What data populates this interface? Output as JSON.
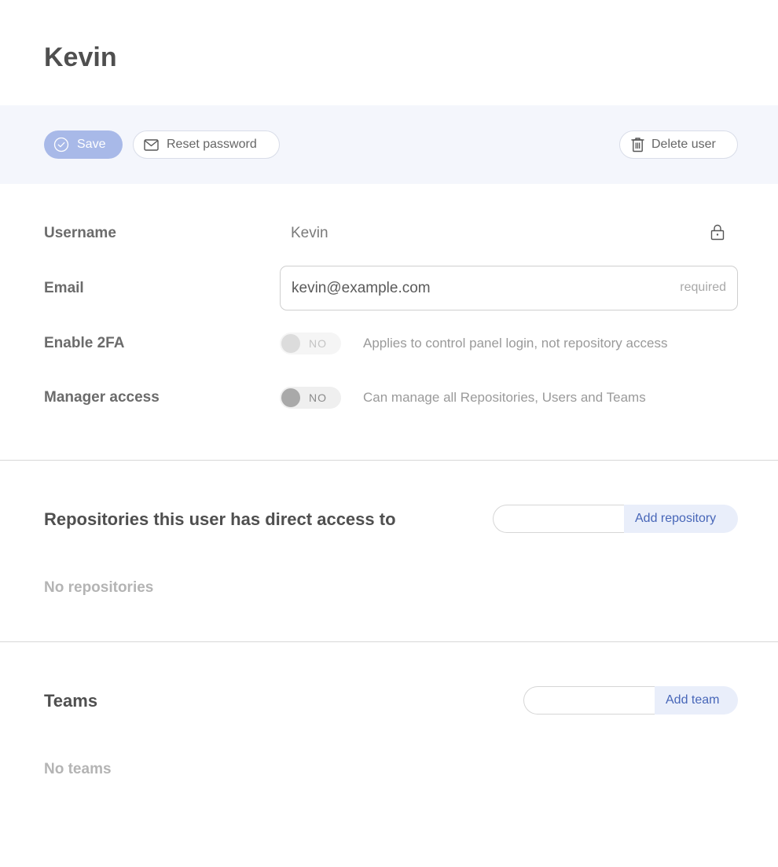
{
  "header": {
    "title": "Kevin"
  },
  "toolbar": {
    "save_label": "Save",
    "reset_password_label": "Reset password",
    "delete_user_label": "Delete user"
  },
  "fields": {
    "username": {
      "label": "Username",
      "value": "Kevin"
    },
    "email": {
      "label": "Email",
      "value": "kevin@example.com",
      "required_text": "required"
    },
    "enable_2fa": {
      "label": "Enable 2FA",
      "toggle_text": "NO",
      "hint": "Applies to control panel login, not repository access"
    },
    "manager_access": {
      "label": "Manager access",
      "toggle_text": "NO",
      "hint": "Can manage all Repositories, Users and Teams"
    }
  },
  "repositories": {
    "title": "Repositories this user has direct access to",
    "add_label": "Add repository",
    "input_value": "",
    "empty_text": "No repositories"
  },
  "teams": {
    "title": "Teams",
    "add_label": "Add team",
    "input_value": "",
    "empty_text": "No teams"
  },
  "icons": {
    "save": "check-circle-icon",
    "reset_password": "envelope-icon",
    "delete_user": "trash-icon",
    "username_lock": "lock-icon"
  },
  "colors": {
    "save_button": "#a8b9e8",
    "toolbar_background": "#f4f6fc",
    "add_button_background": "#e9eefa",
    "add_button_text": "#4766b8"
  }
}
